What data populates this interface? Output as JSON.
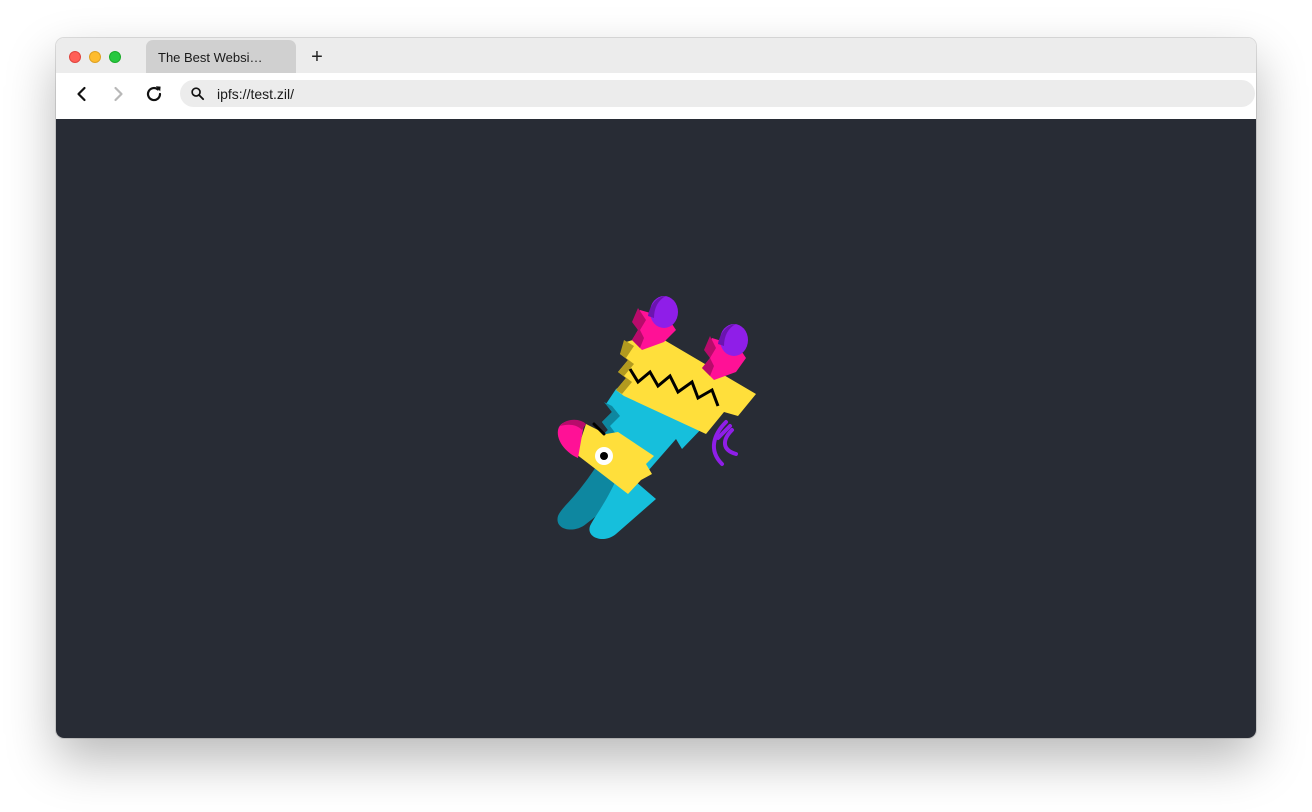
{
  "window": {
    "traffic_lights": {
      "close": "#ff5f57",
      "minimize": "#febc2e",
      "zoom": "#28c840"
    }
  },
  "tabs": [
    {
      "title": "The Best Websi…",
      "active": true
    }
  ],
  "new_tab_label": "+",
  "toolbar": {
    "back_icon": "chevron-left-icon",
    "forward_icon": "chevron-right-icon",
    "reload_icon": "reload-icon",
    "address": "ipfs://test.zil/",
    "address_icon": "search-icon"
  },
  "page": {
    "background": "#282c35",
    "illustration": "pinata-icon",
    "illustration_colors": [
      "#ffdf3b",
      "#16bfdc",
      "#ff1196",
      "#8f1ee8",
      "#000000"
    ]
  }
}
